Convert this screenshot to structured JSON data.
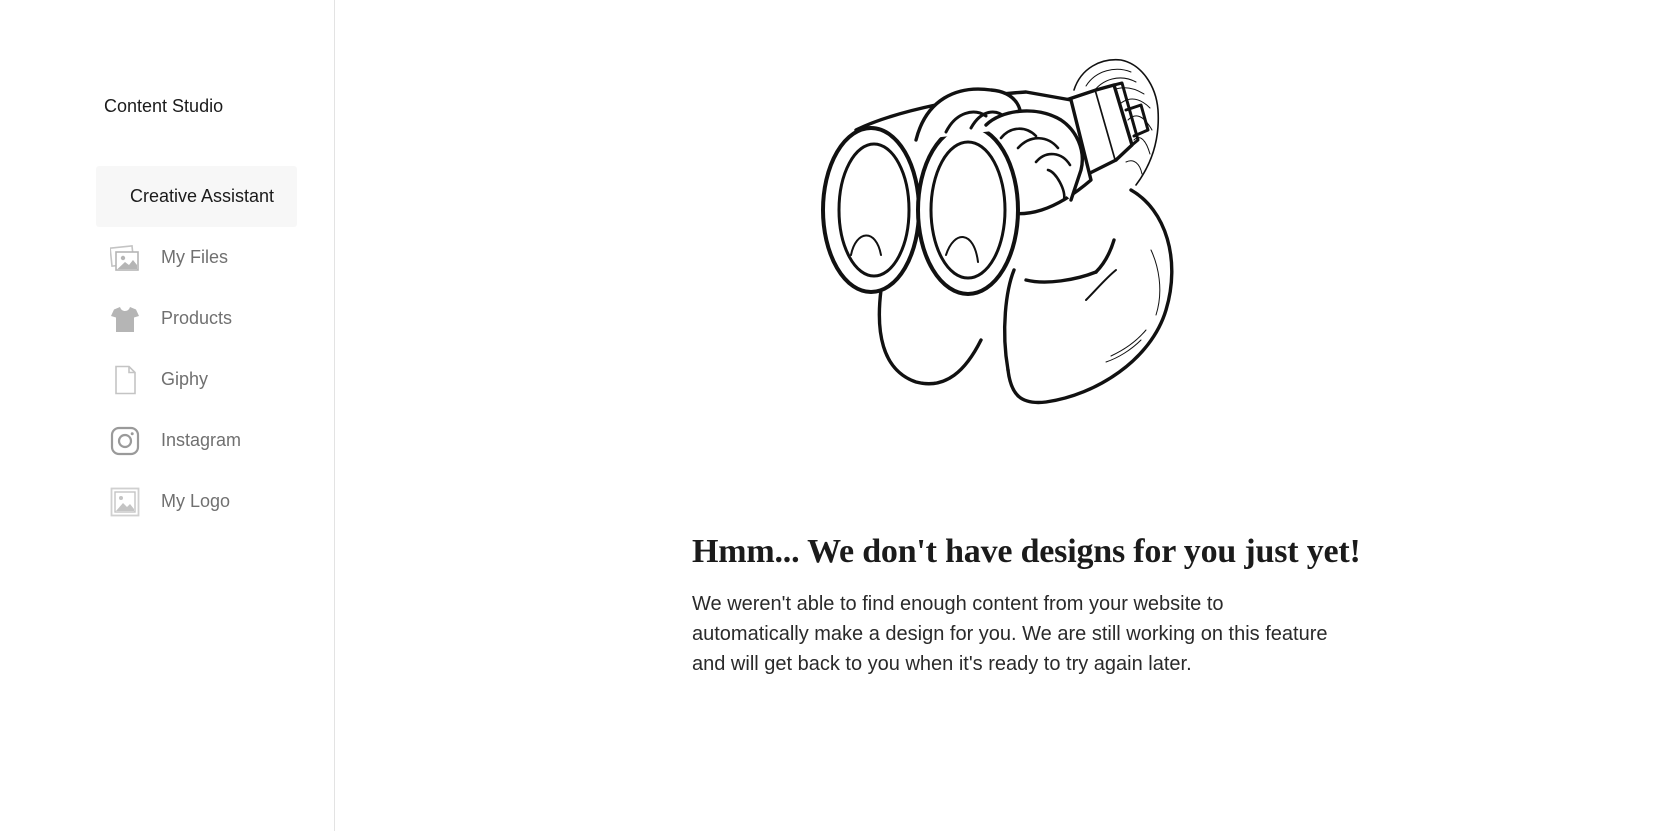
{
  "sidebar": {
    "title": "Content Studio",
    "items": [
      {
        "label": "Creative Assistant",
        "icon": "none",
        "active": true
      },
      {
        "label": "My Files",
        "icon": "images-icon",
        "active": false
      },
      {
        "label": "Products",
        "icon": "tshirt-icon",
        "active": false
      },
      {
        "label": "Giphy",
        "icon": "document-icon",
        "active": false
      },
      {
        "label": "Instagram",
        "icon": "instagram-icon",
        "active": false
      },
      {
        "label": "My Logo",
        "icon": "logo-image-icon",
        "active": false
      }
    ]
  },
  "main": {
    "illustration": "person-with-binoculars",
    "heading": "Hmm... We don't have designs for you just yet!",
    "body": "We weren't able to find enough content from your website to automatically make a design for you. We are still working on this feature and will get back to you when it's ready to try again later."
  },
  "colors": {
    "active_bg": "#f7f7f7",
    "inactive_text": "#707070",
    "primary_text": "#1b1b1b",
    "icon_gray": "#b5b5b5",
    "divider": "#e3e3e3"
  }
}
